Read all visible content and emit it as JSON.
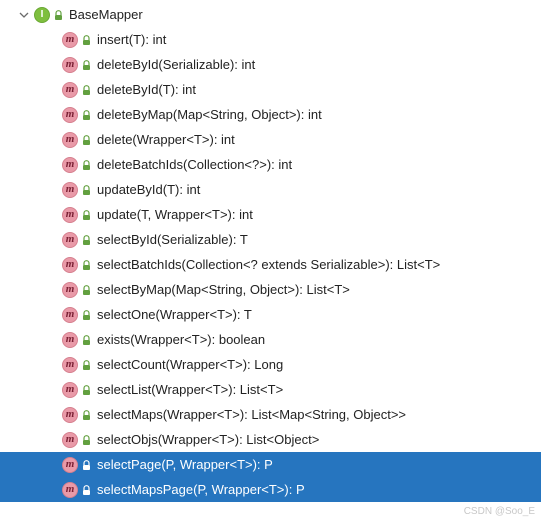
{
  "root": {
    "label": "BaseMapper",
    "kind_letter": "I"
  },
  "methods": [
    {
      "label": "insert(T): int",
      "selected": false
    },
    {
      "label": "deleteById(Serializable): int",
      "selected": false
    },
    {
      "label": "deleteById(T): int",
      "selected": false
    },
    {
      "label": "deleteByMap(Map<String, Object>): int",
      "selected": false
    },
    {
      "label": "delete(Wrapper<T>): int",
      "selected": false
    },
    {
      "label": "deleteBatchIds(Collection<?>): int",
      "selected": false
    },
    {
      "label": "updateById(T): int",
      "selected": false
    },
    {
      "label": "update(T, Wrapper<T>): int",
      "selected": false
    },
    {
      "label": "selectById(Serializable): T",
      "selected": false
    },
    {
      "label": "selectBatchIds(Collection<? extends Serializable>): List<T>",
      "selected": false
    },
    {
      "label": "selectByMap(Map<String, Object>): List<T>",
      "selected": false
    },
    {
      "label": "selectOne(Wrapper<T>): T",
      "selected": false
    },
    {
      "label": "exists(Wrapper<T>): boolean",
      "selected": false
    },
    {
      "label": "selectCount(Wrapper<T>): Long",
      "selected": false
    },
    {
      "label": "selectList(Wrapper<T>): List<T>",
      "selected": false
    },
    {
      "label": "selectMaps(Wrapper<T>): List<Map<String, Object>>",
      "selected": false
    },
    {
      "label": "selectObjs(Wrapper<T>): List<Object>",
      "selected": false
    },
    {
      "label": "selectPage(P, Wrapper<T>): P",
      "selected": true
    },
    {
      "label": "selectMapsPage(P, Wrapper<T>): P",
      "selected": true
    }
  ],
  "method_kind_letter": "m",
  "lock_color_normal": "#62a03f",
  "lock_color_selected": "#ffffff",
  "watermark": "CSDN @Soo_E"
}
